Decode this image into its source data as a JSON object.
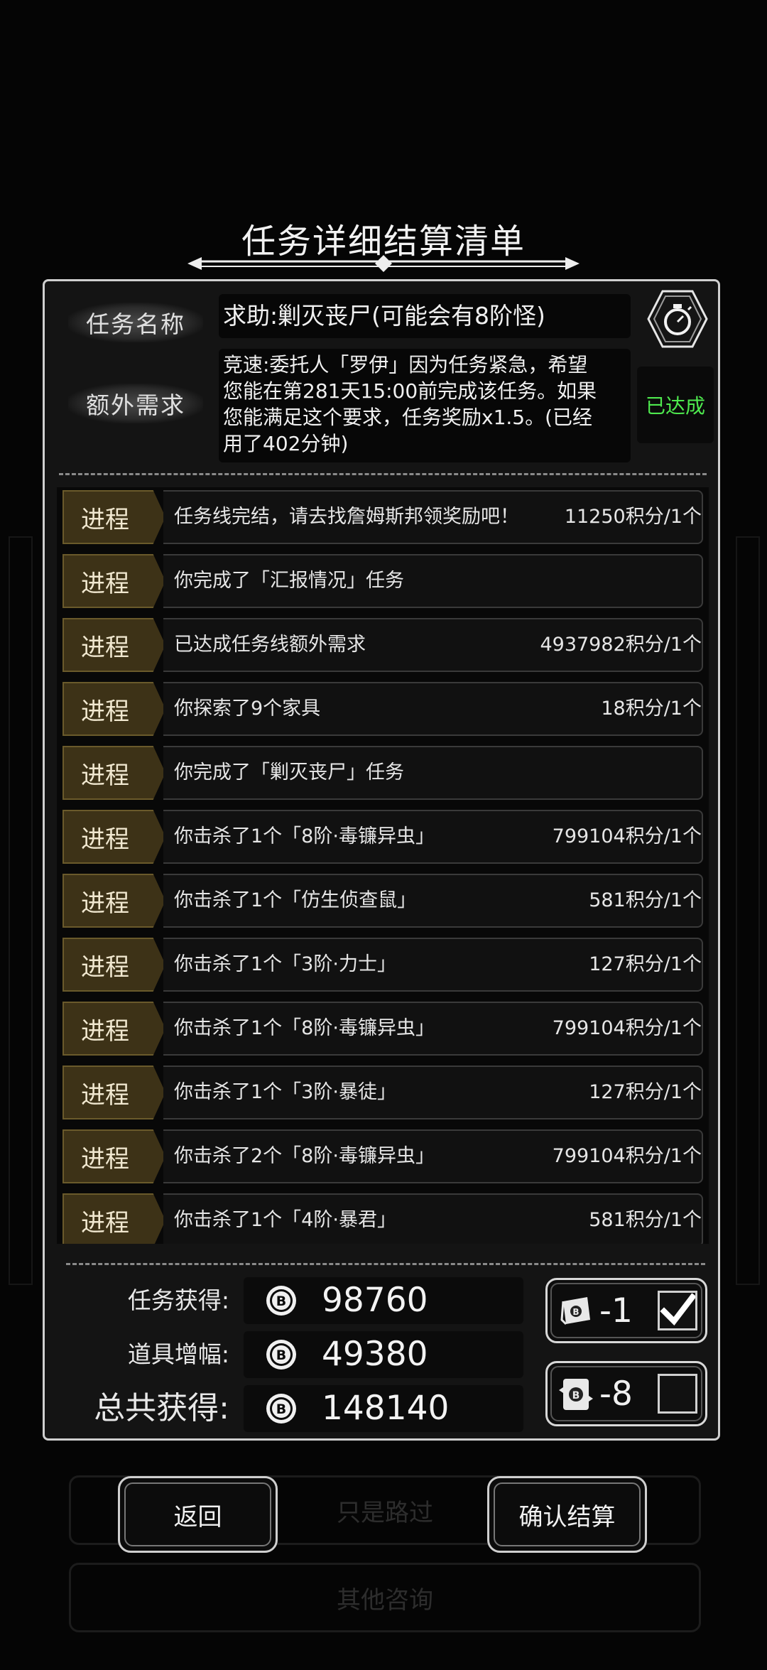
{
  "background": {
    "button_1": "只是路过",
    "button_2": "其他咨询"
  },
  "title": "任务详细结算清单",
  "header": {
    "task_name_label": "任务名称",
    "task_name": "求助:剿灭丧尸(可能会有8阶怪)",
    "extra_label": "额外需求",
    "extra_lines": [
      "竞速:委托人「罗伊」因为任务紧急，希望",
      "您能在第281天15:00前完成该任务。如果",
      "您能满足这个要求，任务奖励x1.5。(已经",
      "用了402分钟)"
    ],
    "status": "已达成",
    "status_color": "#4ee84e",
    "timer_icon": "stopwatch-icon"
  },
  "progress": {
    "tag": "进程",
    "rows": [
      {
        "text": "任务线完结，请去找詹姆斯邦领奖励吧！",
        "score": "11250积分/1个"
      },
      {
        "text": "你完成了「汇报情况」任务",
        "score": ""
      },
      {
        "text": "已达成任务线额外需求",
        "score": "4937982积分/1个"
      },
      {
        "text": "你探索了9个家具",
        "score": "18积分/1个"
      },
      {
        "text": "你完成了「剿灭丧尸」任务",
        "score": ""
      },
      {
        "text": "你击杀了1个「8阶·毒镰异虫」",
        "score": "799104积分/1个"
      },
      {
        "text": "你击杀了1个「仿生侦查鼠」",
        "score": "581积分/1个"
      },
      {
        "text": "你击杀了1个「3阶·力士」",
        "score": "127积分/1个"
      },
      {
        "text": "你击杀了1个「8阶·毒镰异虫」",
        "score": "799104积分/1个"
      },
      {
        "text": "你击杀了1个「3阶·暴徒」",
        "score": "127积分/1个"
      },
      {
        "text": "你击杀了2个「8阶·毒镰异虫」",
        "score": "799104积分/1个"
      },
      {
        "text": "你击杀了1个「4阶·暴君」",
        "score": "581积分/1个"
      }
    ]
  },
  "summary": {
    "task_label": "任务获得:",
    "task_value": "98760",
    "item_label": "道具增幅:",
    "item_value": "49380",
    "total_label": "总共获得:",
    "total_value": "148140",
    "coin_icon": "coin-icon"
  },
  "items": [
    {
      "icon": "scroll-ticket-icon",
      "count": "-1",
      "checked": true
    },
    {
      "icon": "card-ticket-icon",
      "count": "-8",
      "checked": false
    }
  ],
  "buttons": {
    "back": "返回",
    "confirm": "确认结算"
  }
}
